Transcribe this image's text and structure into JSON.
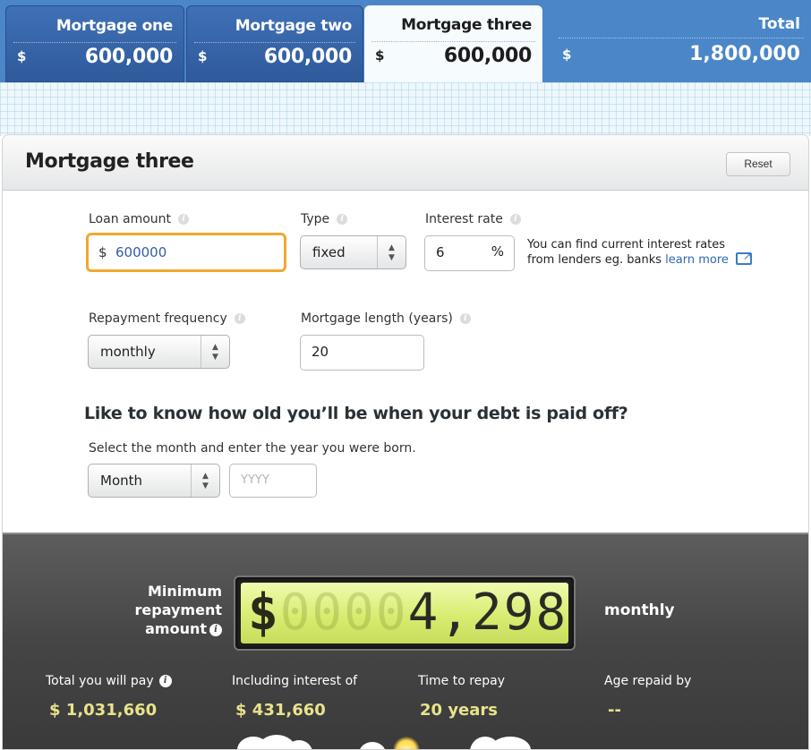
{
  "tabs": [
    {
      "title": "Mortgage one",
      "currency": "$",
      "value": "600,000",
      "active": false
    },
    {
      "title": "Mortgage two",
      "currency": "$",
      "value": "600,000",
      "active": false
    },
    {
      "title": "Mortgage three",
      "currency": "$",
      "value": "600,000",
      "active": true
    }
  ],
  "total": {
    "title": "Total",
    "currency": "$",
    "value": "1,800,000"
  },
  "colors": {
    "accent_blue": "#4a86c8",
    "highlight_orange": "#f0a92e",
    "lcd_green": "#d9ec72",
    "result_value": "#e8e38c"
  },
  "card": {
    "title": "Mortgage three",
    "reset_label": "Reset"
  },
  "form": {
    "loan_amount": {
      "label": "Loan amount",
      "currency": "$",
      "value": "600000"
    },
    "type": {
      "label": "Type",
      "value": "fixed"
    },
    "interest_rate": {
      "label": "Interest rate",
      "value": "6",
      "unit": "%"
    },
    "help_text_line1": "You can find current interest rates",
    "help_text_line2": "from lenders eg. banks",
    "help_link": "learn more",
    "repayment_frequency": {
      "label": "Repayment frequency",
      "value": "monthly"
    },
    "mortgage_length": {
      "label": "Mortgage length (years)",
      "value": "20"
    },
    "age_question": "Like to know how old you’ll be when your debt is paid off?",
    "age_instruction": "Select the month and enter the year you were born.",
    "birth_month": {
      "value": "Month"
    },
    "birth_year": {
      "placeholder": "YYYY"
    }
  },
  "results": {
    "min_label_line1": "Minimum",
    "min_label_line2": "repayment",
    "min_label_line3": "amount",
    "lcd_dollar": "$",
    "lcd_ghost": "0000",
    "lcd_value": "4,298",
    "frequency": "monthly",
    "total_pay_label": "Total you will pay",
    "total_pay_value": "$ 1,031,660",
    "interest_label": "Including interest of",
    "interest_value": "$ 431,660",
    "time_label": "Time to repay",
    "time_value": "20 years",
    "age_label": "Age repaid by",
    "age_value": "--"
  },
  "icons": [
    "info-icon",
    "select-arrows-icon",
    "external-link-icon",
    "cloud-icon",
    "sun-icon"
  ]
}
